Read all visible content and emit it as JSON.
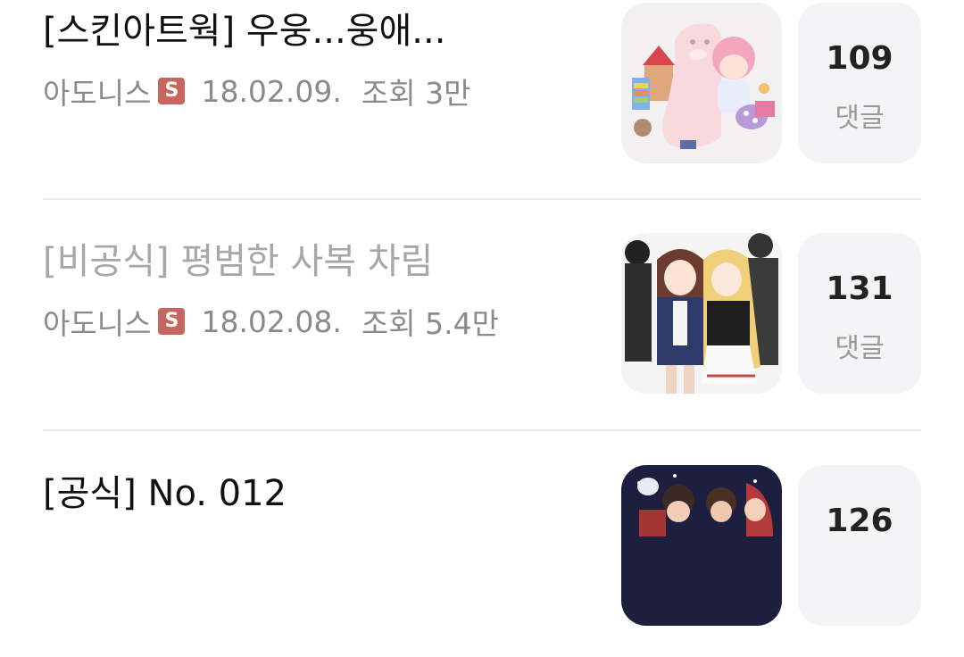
{
  "posts": [
    {
      "title": "[스킨아트웍] 우웅...웅애...",
      "author": "아도니스",
      "badge": "S",
      "date": "18.02.09.",
      "views": "조회 3만",
      "comment_count": "109",
      "comment_label": "댓글",
      "read": false
    },
    {
      "title": "[비공식] 평범한 사복 차림",
      "author": "아도니스",
      "badge": "S",
      "date": "18.02.08.",
      "views": "조회 5.4만",
      "comment_count": "131",
      "comment_label": "댓글",
      "read": true
    },
    {
      "title": "[공식] No. 012",
      "author": "",
      "badge": "",
      "date": "",
      "views": "",
      "comment_count": "126",
      "comment_label": "",
      "read": false
    }
  ],
  "colors": {
    "badge": "#c8655f",
    "read_title": "#a7a7a7",
    "meta": "#8a8a8a",
    "comment_bg": "#f4f4f6"
  }
}
